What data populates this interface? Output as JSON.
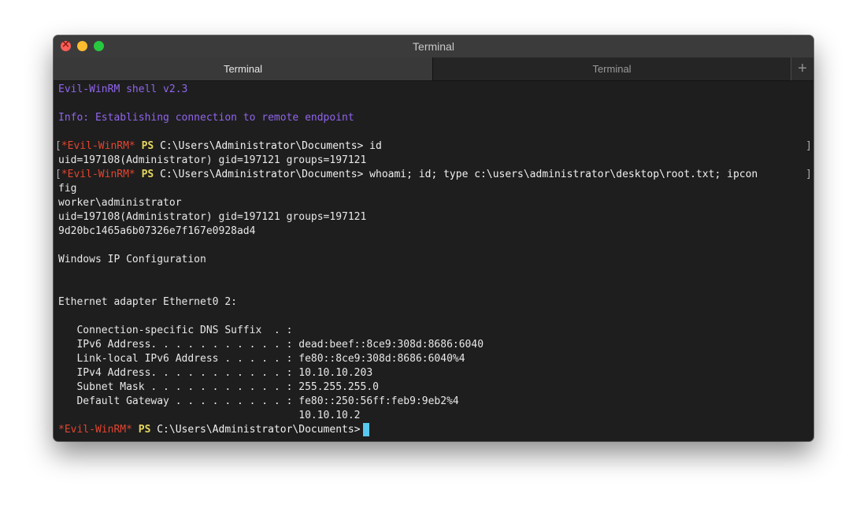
{
  "window": {
    "title": "Terminal"
  },
  "tabs": [
    {
      "label": "Terminal",
      "active": true
    },
    {
      "label": "Terminal",
      "active": false
    }
  ],
  "add_tab_glyph": "+",
  "terminal": {
    "banner": "Evil-WinRM shell v2.3",
    "info": "Info: Establishing connection to remote endpoint",
    "prompt_name": "*Evil-WinRM*",
    "prompt_ps": "PS",
    "prompt_path": "C:\\Users\\Administrator\\Documents>",
    "prompt_open_bracket": "[",
    "prompt_close_bracket": "]",
    "cmd1": "id",
    "out1": "uid=197108(Administrator) gid=197121 groups=197121",
    "cmd2": "whoami; id; type c:\\users\\administrator\\desktop\\root.txt; ipcon",
    "cmd2_wrap": "fig",
    "out2": [
      "worker\\administrator",
      "uid=197108(Administrator) gid=197121 groups=197121",
      "9d20bc1465a6b07326e7f167e0928ad4",
      "",
      "Windows IP Configuration",
      "",
      "",
      "Ethernet adapter Ethernet0 2:",
      "",
      "   Connection-specific DNS Suffix  . :",
      "   IPv6 Address. . . . . . . . . . . : dead:beef::8ce9:308d:8686:6040",
      "   Link-local IPv6 Address . . . . . : fe80::8ce9:308d:8686:6040%4",
      "   IPv4 Address. . . . . . . . . . . : 10.10.10.203",
      "   Subnet Mask . . . . . . . . . . . : 255.255.255.0",
      "   Default Gateway . . . . . . . . . : fe80::250:56ff:feb9:9eb2%4",
      "                                       10.10.10.2"
    ]
  },
  "colors": {
    "banner": "#9065ec",
    "prompt_name": "#e2452f",
    "prompt_ps": "#e6d85b",
    "cursor": "#58c8ef",
    "background": "#1e1e1e"
  }
}
